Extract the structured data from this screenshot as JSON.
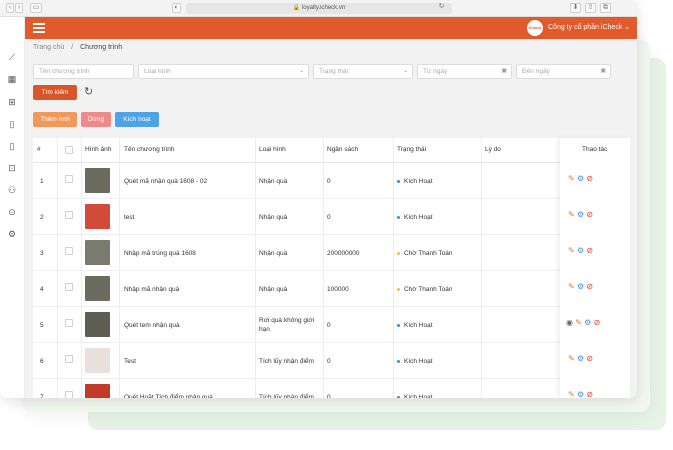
{
  "browser": {
    "url": "loyalty.icheck.vn"
  },
  "header": {
    "company_logo_text": "iCheck",
    "company_name": "Công ty cổ phần iCheck ⌄"
  },
  "breadcrumb": {
    "home": "Trang chủ",
    "separator": "/",
    "current": "Chương trình"
  },
  "filters": {
    "program_name": "Tên chương trình",
    "type": "Loại hình",
    "status": "Trạng thái",
    "from_date": "Từ ngày",
    "to_date": "Đến ngày"
  },
  "buttons": {
    "search": "Tìm kiếm",
    "add": "Thêm mới",
    "stop": "Dừng",
    "activate": "Kích hoạt"
  },
  "table": {
    "headers": {
      "index": "#",
      "image": "Hình ảnh",
      "name": "Tên chương trình",
      "type": "Loại hình",
      "budget": "Ngân sách",
      "status": "Trạng thái",
      "reason": "Lý do",
      "actions": "Thao tác"
    },
    "rows": [
      {
        "index": "1",
        "name": "Quét mã nhận quà 1608 - 02",
        "type": "Nhận quà",
        "type2": "",
        "budget": "0",
        "status": "Kích Hoạt",
        "status_color": "#3a8fd9",
        "thumb": "#6b6b5e"
      },
      {
        "index": "2",
        "name": "test",
        "type": "Nhận quà",
        "type2": "",
        "budget": "0",
        "status": "Kích Hoạt",
        "status_color": "#3a8fd9",
        "thumb": "#d24a3a"
      },
      {
        "index": "3",
        "name": "Nhập mã trúng quà 1608",
        "type": "Nhận quà",
        "type2": "",
        "budget": "200000000",
        "status": "Chờ Thanh Toán",
        "status_color": "#f0c030",
        "thumb": "#7a7a6e"
      },
      {
        "index": "4",
        "name": "Nhập mã nhận quà",
        "type": "Nhận quà",
        "type2": "",
        "budget": "100000",
        "status": "Chờ Thanh Toán",
        "status_color": "#f0c030",
        "thumb": "#6b6b5e"
      },
      {
        "index": "5",
        "name": "Quét tem nhận quà",
        "type": "Rơi quà không giới",
        "type2": "hạn",
        "budget": "0",
        "status": "Kích Hoạt",
        "status_color": "#3a8fd9",
        "thumb": "#5e5e52"
      },
      {
        "index": "6",
        "name": "Test",
        "type": "Tích lũy nhận điểm",
        "type2": "",
        "budget": "0",
        "status": "Kích Hoạt",
        "status_color": "#3a8fd9",
        "thumb": "#e8e0dc"
      },
      {
        "index": "7",
        "name": "Quét Hoặt Tích điểm nhận quà",
        "type": "Tích lũy nhận điểm",
        "type2": "",
        "budget": "0",
        "status": "Kích Hoạt",
        "status_color": "#3a8fd9",
        "thumb": "#c23a2a"
      }
    ]
  }
}
